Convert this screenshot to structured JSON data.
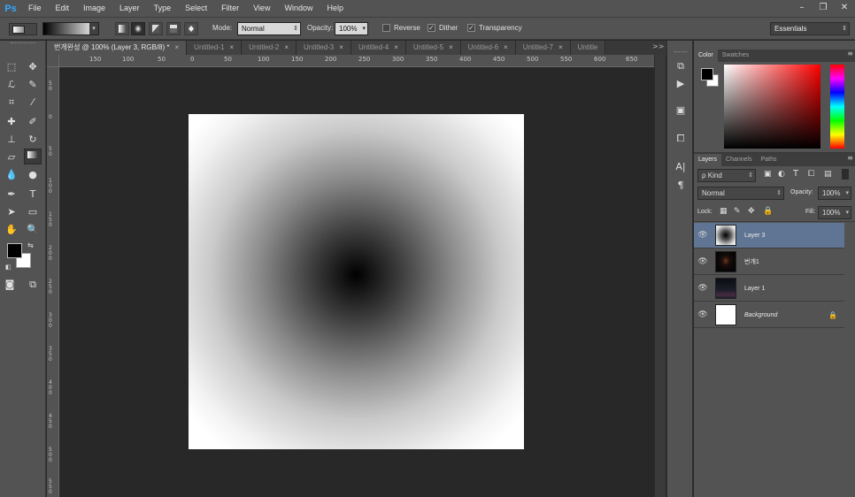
{
  "app": {
    "logo": "Ps"
  },
  "menu": [
    "File",
    "Edit",
    "Image",
    "Layer",
    "Type",
    "Select",
    "Filter",
    "View",
    "Window",
    "Help"
  ],
  "window_controls": {
    "minimize": "–",
    "restore": "❐",
    "close": "✕"
  },
  "options": {
    "mode_label": "Mode:",
    "mode_value": "Normal",
    "opacity_label": "Opacity:",
    "opacity_value": "100%",
    "reverse_label": "Reverse",
    "reverse_checked": false,
    "dither_label": "Dither",
    "dither_checked": true,
    "transparency_label": "Transparency",
    "transparency_checked": true,
    "workspace": "Essentials"
  },
  "tabs": [
    {
      "label": "번개완성 @ 100% (Layer 3, RGB/8) *",
      "active": true
    },
    {
      "label": "Untitled-1",
      "active": false
    },
    {
      "label": "Untitled-2",
      "active": false
    },
    {
      "label": "Untitled-3",
      "active": false
    },
    {
      "label": "Untitled-4",
      "active": false
    },
    {
      "label": "Untitled-5",
      "active": false
    },
    {
      "label": "Untitled-6",
      "active": false
    },
    {
      "label": "Untitled-7",
      "active": false
    },
    {
      "label": "Untitle",
      "active": false
    }
  ],
  "tab_overflow": ">>",
  "ruler": {
    "h_labels": [
      "150",
      "100",
      "50",
      "0",
      "50",
      "100",
      "150",
      "200",
      "250",
      "300",
      "350",
      "400",
      "450",
      "500",
      "550",
      "600",
      "650"
    ],
    "v_labels": [
      "5 0",
      "0",
      "5 0",
      "1 0 0",
      "1 5 0",
      "2 0 0",
      "2 5 0",
      "3 0 0",
      "3 5 0",
      "4 0 0",
      "4 5 0",
      "5 0 0",
      "5 5 0"
    ]
  },
  "color_panel": {
    "tabs": [
      "Color",
      "Swatches"
    ],
    "fg": "#000000",
    "bg": "#ffffff"
  },
  "layers_panel": {
    "tabs": [
      "Layers",
      "Channels",
      "Paths"
    ],
    "filter_label": "ρ Kind",
    "blend_mode": "Normal",
    "opacity_label": "Opacity:",
    "opacity_value": "100%",
    "lock_label": "Lock:",
    "fill_label": "Fill:",
    "fill_value": "100%",
    "layers": [
      {
        "name": "Layer 3",
        "selected": true,
        "italic": false,
        "locked": false
      },
      {
        "name": "번개1",
        "selected": false,
        "italic": false,
        "locked": false
      },
      {
        "name": "Layer 1",
        "selected": false,
        "italic": false,
        "locked": false
      },
      {
        "name": "Background",
        "selected": false,
        "italic": true,
        "locked": true
      }
    ]
  }
}
